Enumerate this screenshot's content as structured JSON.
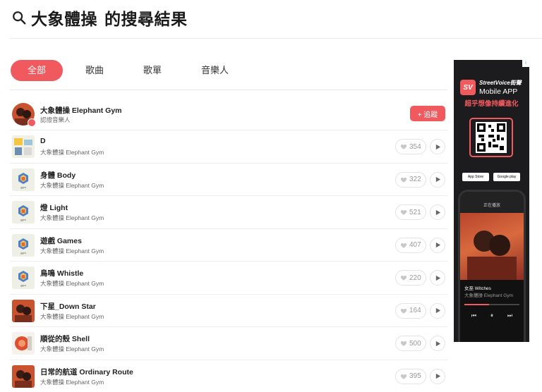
{
  "header": {
    "keyword": "大象體操",
    "suffix": "的搜尋結果"
  },
  "tabs": [
    {
      "label": "全部",
      "active": true
    },
    {
      "label": "歌曲",
      "active": false
    },
    {
      "label": "歌單",
      "active": false
    },
    {
      "label": "音樂人",
      "active": false
    }
  ],
  "artist": {
    "name": "大象體操 Elephant Gym",
    "subtitle": "認證音樂人",
    "follow_label": "+ 追蹤"
  },
  "songs": [
    {
      "title": "D",
      "artist": "大象體操 Elephant Gym",
      "likes": "354",
      "cover": "d"
    },
    {
      "title": "身體 Body",
      "artist": "大象體操 Elephant Gym",
      "likes": "322",
      "cover": "logo"
    },
    {
      "title": "燈 Light",
      "artist": "大象體操 Elephant Gym",
      "likes": "521",
      "cover": "logo"
    },
    {
      "title": "遊戲 Games",
      "artist": "大象體操 Elephant Gym",
      "likes": "407",
      "cover": "logo"
    },
    {
      "title": "鳥鳴 Whistle",
      "artist": "大象體操 Elephant Gym",
      "likes": "220",
      "cover": "logo"
    },
    {
      "title": "下星_Down Star",
      "artist": "大象體操 Elephant Gym",
      "likes": "164",
      "cover": "photo"
    },
    {
      "title": "順從的殼 Shell",
      "artist": "大象體操 Elephant Gym",
      "likes": "500",
      "cover": "shell"
    },
    {
      "title": "日常的航道 Ordinary Route",
      "artist": "大象體操 Elephant Gym",
      "likes": "395",
      "cover": "photo"
    }
  ],
  "ad": {
    "logo_mark": "SV",
    "brand_line1": "StreetVoice街聲",
    "brand_line2": "Mobile APP",
    "slogan": "超乎想像持續進化",
    "store1": "App Store",
    "store2": "Google play",
    "player_title": "女巫 Witches",
    "player_artist": "大象體操 Elephant Gym",
    "screen_header": "正在播放"
  },
  "colors": {
    "accent": "#f05a5f"
  }
}
